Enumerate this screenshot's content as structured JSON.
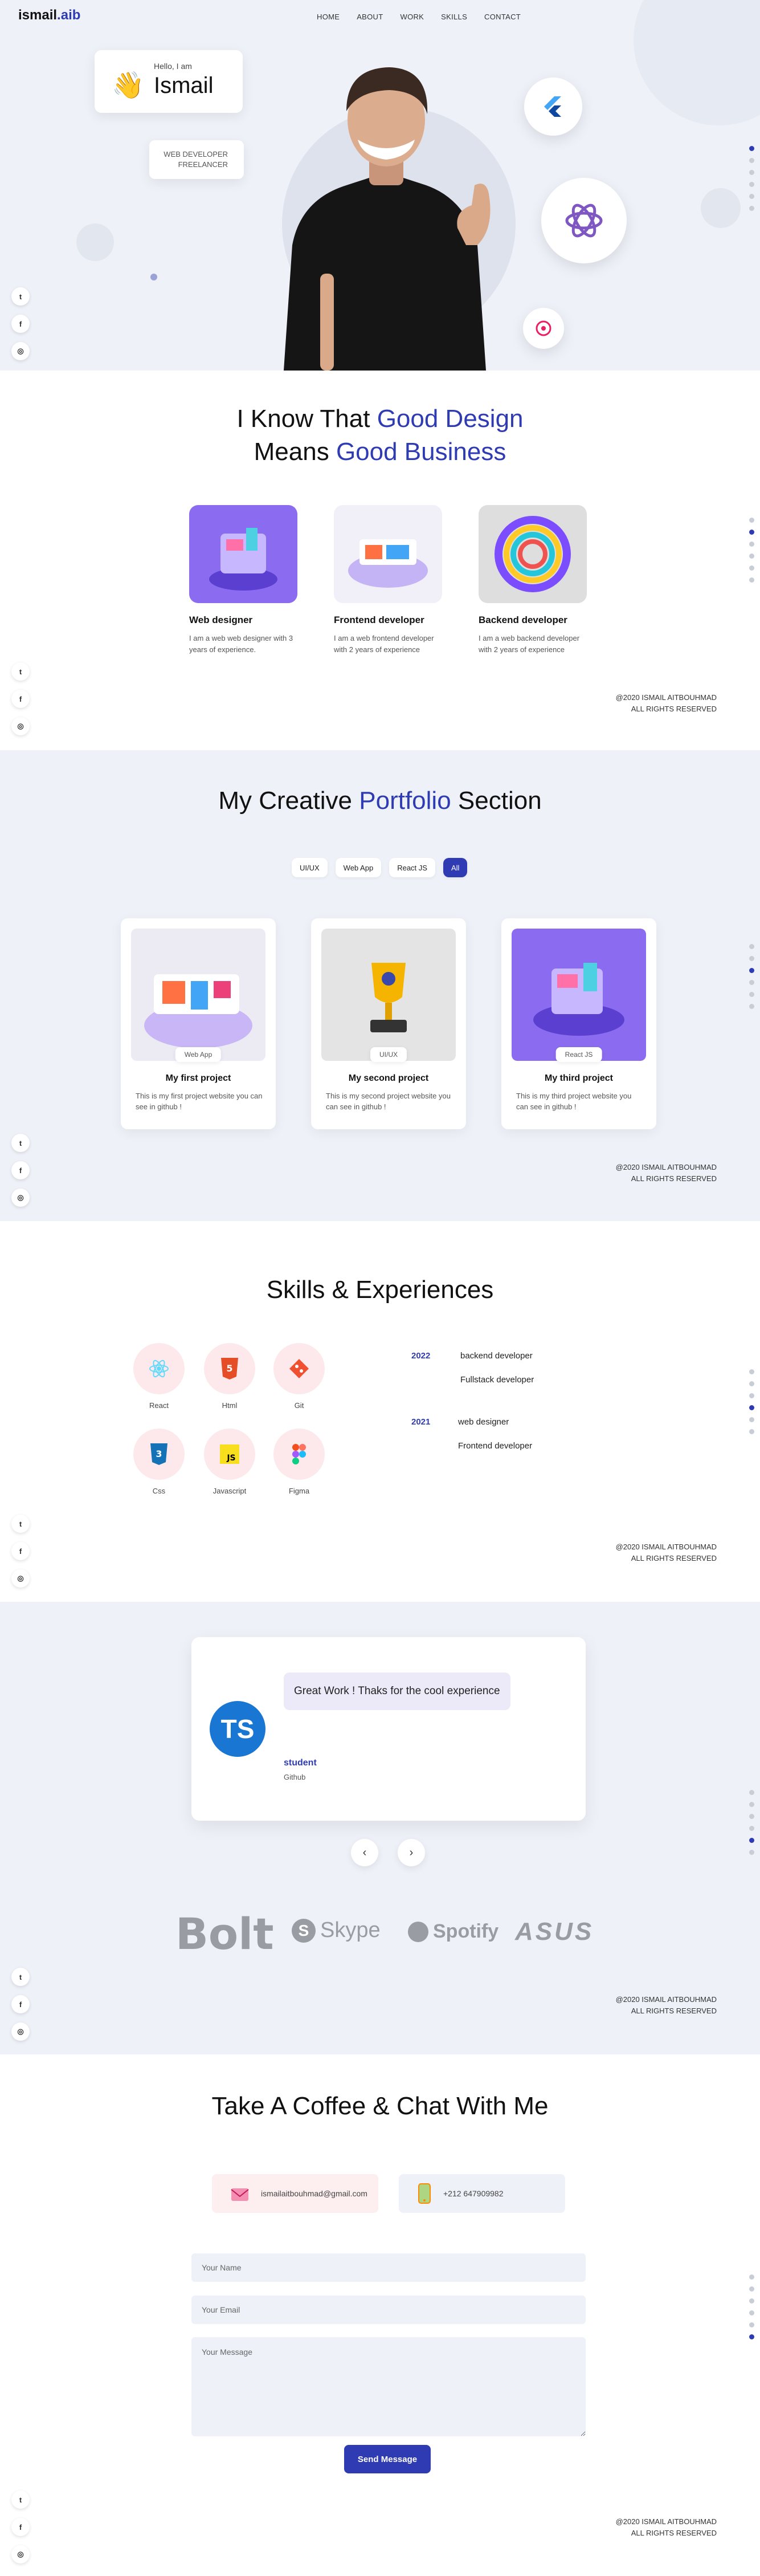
{
  "logo": {
    "name": "ismail",
    "suffix": ".aib"
  },
  "nav": {
    "links": [
      "HOME",
      "ABOUT",
      "WORK",
      "SKILLS",
      "CONTACT"
    ]
  },
  "hero": {
    "hello": "Hello, I am",
    "name": "Ismail",
    "role_line1": "WEB DEVELOPER",
    "role_line2": "FREELANCER"
  },
  "copyright": {
    "line1": "@2020 ISMAIL AITBOUHMAD",
    "line2": "ALL RIGHTS RESERVED"
  },
  "social": [
    "twitter-icon",
    "facebook-icon",
    "instagram-icon"
  ],
  "about": {
    "title_pre": "I Know That ",
    "title_accent1": "Good Design",
    "title_mid": "Means ",
    "title_accent2": "Good Business",
    "services": [
      {
        "title": "Web designer",
        "desc": "I am a web web designer with 3 years of experience."
      },
      {
        "title": "Frontend developer",
        "desc": "I am a web frontend developer with 2 years of experience"
      },
      {
        "title": "Backend developer",
        "desc": "I am a web backend developer with 2 years of experience"
      }
    ]
  },
  "portfolio": {
    "title_pre": "My Creative ",
    "title_accent": "Portfolio",
    "title_post": " Section",
    "filters": [
      "UI/UX",
      "Web App",
      "React JS",
      "All"
    ],
    "active_filter": "All",
    "projects": [
      {
        "tag": "Web App",
        "title": "My first project",
        "desc": "This is my first project website you can see in github !"
      },
      {
        "tag": "UI/UX",
        "title": "My second project",
        "desc": "This is my second project website you can see in github !"
      },
      {
        "tag": "React JS",
        "title": "My third project",
        "desc": "This is my third project website you can see in github !"
      }
    ]
  },
  "skills": {
    "title": "Skills & Experiences",
    "items": [
      "React",
      "Html",
      "Git",
      "Css",
      "Javascript",
      "Figma"
    ],
    "timeline": [
      {
        "year": "2022",
        "items": [
          "backend developer",
          "Fullstack developer"
        ]
      },
      {
        "year": "2021",
        "items": [
          "web designer",
          "Frontend developer"
        ]
      }
    ]
  },
  "testimonial": {
    "quote": "Great Work ! Thaks for the cool experience",
    "initials": "TS",
    "name": "student",
    "company": "Github",
    "prev": "‹",
    "next": "›"
  },
  "brands": [
    "Bolt",
    "Skype",
    "Spotify",
    "ASUS"
  ],
  "contact": {
    "title": "Take A Coffee & Chat With Me",
    "email": "ismailaitbouhmad@gmail.com",
    "phone": "+212 647909982",
    "name_placeholder": "Your Name",
    "email_placeholder": "Your Email",
    "message_placeholder": "Your Message",
    "send_label": "Send Message"
  },
  "colors": {
    "accent": "#2f3bb3",
    "section_bg": "#eef1f8",
    "skill_bg": "#fde9ec"
  }
}
